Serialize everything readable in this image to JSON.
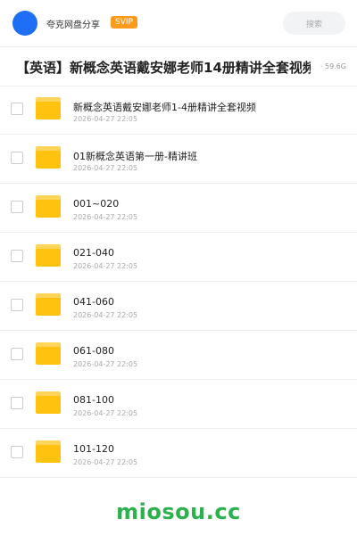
{
  "header": {
    "brand": "夸克网盘分享",
    "badge": "SVIP",
    "search_placeholder": "搜索"
  },
  "share": {
    "title": "【英语】新概念英语戴安娜老师14册精讲全套视频",
    "meta": "· 59.6G"
  },
  "files": [
    {
      "name": "新概念英语戴安娜老师1-4册精讲全套视频",
      "date": "2026-04-27 22:05"
    },
    {
      "name": "01新概念英语第一册-精讲班",
      "date": "2026-04-27 22:05"
    },
    {
      "name": "001~020",
      "date": "2026-04-27 22:05"
    },
    {
      "name": "021-040",
      "date": "2026-04-27 22:05"
    },
    {
      "name": "041-060",
      "date": "2026-04-27 22:05"
    },
    {
      "name": "061-080",
      "date": "2026-04-27 22:05"
    },
    {
      "name": "081-100",
      "date": "2026-04-27 22:05"
    },
    {
      "name": "101-120",
      "date": "2026-04-27 22:05"
    }
  ],
  "footer": {
    "watermark": "miosou.cc"
  },
  "colors": {
    "accent": "#1e6ff5",
    "svip": "#ff9b1a",
    "folder": "#ffc20e",
    "watermark": "#2bb24c"
  }
}
